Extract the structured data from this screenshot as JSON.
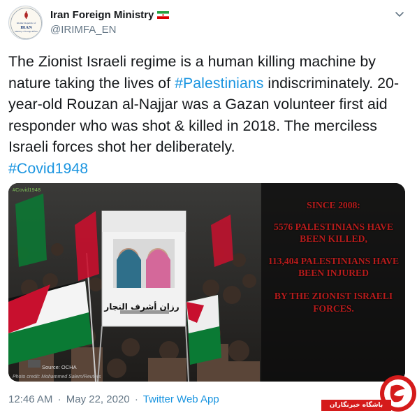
{
  "account": {
    "display_name": "Iran Foreign Ministry",
    "handle": "@IRIMFA_EN",
    "avatar_text_1": "Islamic Republic of",
    "avatar_text_2": "IRAN",
    "avatar_text_3": "Ministry of Foreign Affairs"
  },
  "tweet": {
    "text_1": "The Zionist Israeli regime is a human killing machine by nature taking the lives of ",
    "hashtag_1": "#Palestinians",
    "text_2": " indiscriminately. 20-year-old Rouzan al-Najjar was a Gazan volunteer first aid responder who was shot & killed in 2018. The merciless Israeli forces shot her deliberately.",
    "hashtag_2": "#Covid1948"
  },
  "media": {
    "tag": "#Covid1948",
    "poster_name": "رزان أشرف النجار",
    "stats": [
      "SINCE 2008:",
      "5576 PALESTINIANS HAVE BEEN KILLED,",
      "113,404 PALESTINIANS HAVE BEEN INJURED",
      "BY THE ZIONIST ISRAELI FORCES."
    ],
    "source": "Source: OCHA",
    "photo_credit": "Photo credit: Mohammed Salem/Reuters"
  },
  "footer": {
    "time": "12:46 AM",
    "separator": "·",
    "date": "May 22, 2020",
    "source": "Twitter Web App"
  },
  "watermark": {
    "label": "باشگاه خبرنگاران"
  },
  "colors": {
    "hashtag": "#1b95e0",
    "stats_red": "#b71c1c",
    "secondary_text": "#657786"
  }
}
